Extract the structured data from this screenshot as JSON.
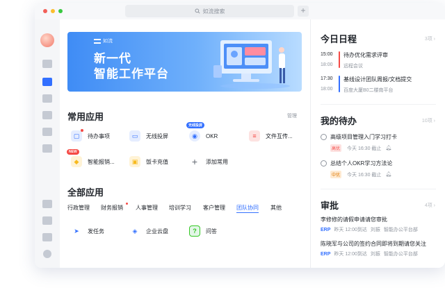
{
  "titlebar": {
    "search_placeholder": "如流搜索",
    "dot_colors": [
      "#f25f58",
      "#fbbe2e",
      "#38c840"
    ]
  },
  "banner": {
    "logo_text": "如流",
    "line1": "新一代",
    "line2": "智能工作平台"
  },
  "common_apps": {
    "title": "常用应用",
    "manage": "管理",
    "items": [
      {
        "label": "待办事项",
        "icon": "todo-icon",
        "badge": "dot",
        "color": "#3370ff"
      },
      {
        "label": "无线投屏",
        "icon": "screen-cast-icon",
        "color": "#3370ff"
      },
      {
        "label": "OKR",
        "icon": "okr-icon",
        "tag": "无线投屏",
        "color": "#3370ff"
      },
      {
        "label": "文件互传...",
        "icon": "file-transfer-icon",
        "color": "#f54a45"
      },
      {
        "label": "智能报销...",
        "icon": "reimburse-icon",
        "tag": "NEW",
        "color": "#f7ba1e"
      },
      {
        "label": "饭卡充值",
        "icon": "meal-card-icon",
        "color": "#f7ba1e"
      },
      {
        "label": "添加常用",
        "icon": "plus-icon",
        "color": "#646a73"
      }
    ]
  },
  "all_apps": {
    "title": "全部应用",
    "categories": [
      "行政管理",
      "财务报销",
      "人事管理",
      "培训学习",
      "客户管理",
      "团队协同",
      "其他"
    ],
    "active_category": "团队协同",
    "items": [
      {
        "label": "发任务",
        "icon": "send-task-icon"
      },
      {
        "label": "企业云盘",
        "icon": "cloud-drive-icon"
      },
      {
        "label": "问答",
        "icon": "qa-icon"
      }
    ]
  },
  "schedule": {
    "title": "今日日程",
    "more": "3项",
    "events": [
      {
        "start": "15:00",
        "end": "18:00",
        "title": "待办优化需求评审",
        "sub": "远程会议",
        "color": "#f54a45"
      },
      {
        "start": "17:30",
        "end": "18:00",
        "title": "基线设计团队周报/文档提交",
        "sub": "百度大厦B0二楼南平台",
        "color": "#3370ff"
      }
    ]
  },
  "todos": {
    "title": "我的待办",
    "more": "10项",
    "items": [
      {
        "title": "高级项目管理入门学习打卡",
        "priority": "高优",
        "priority_color": "#f54a45",
        "priority_bg": "#fde2e1",
        "due": "今天 16:30 截止"
      },
      {
        "title": "总结个人OKR学习方法论",
        "priority": "中优",
        "priority_color": "#de7802",
        "priority_bg": "#feead2",
        "due": "今天 16:30 截止"
      }
    ]
  },
  "approvals": {
    "title": "审批",
    "more": "4项",
    "items": [
      {
        "title": "李修修的请假申请请您审批",
        "source": "ERP",
        "time": "昨天 12:00到达",
        "person": "刘振",
        "org": "智能办公平台部"
      },
      {
        "title": "陈晓军与公司的签约合同即将到期请您关注",
        "source": "ERP",
        "time": "昨天 12:00到达",
        "person": "刘振",
        "org": "智能办公平台部"
      }
    ]
  }
}
